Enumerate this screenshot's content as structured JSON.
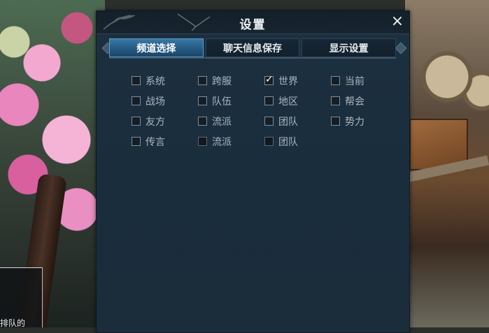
{
  "dialog": {
    "title": "设置",
    "close_symbol": "×"
  },
  "tabs": [
    {
      "label": "频道选择",
      "active": true
    },
    {
      "label": "聊天信息保存",
      "active": false
    },
    {
      "label": "显示设置",
      "active": false
    }
  ],
  "channels": [
    {
      "label": "系统",
      "checked": false
    },
    {
      "label": "跨服",
      "checked": false
    },
    {
      "label": "世界",
      "checked": true
    },
    {
      "label": "当前",
      "checked": false
    },
    {
      "label": "战场",
      "checked": false
    },
    {
      "label": "队伍",
      "checked": false
    },
    {
      "label": "地区",
      "checked": false
    },
    {
      "label": "帮会",
      "checked": false
    },
    {
      "label": "友方",
      "checked": false
    },
    {
      "label": "流派",
      "checked": false
    },
    {
      "label": "团队",
      "checked": false
    },
    {
      "label": "势力",
      "checked": false
    },
    {
      "label": "传言",
      "checked": false
    },
    {
      "label": "流派",
      "checked": false
    },
    {
      "label": "团队",
      "checked": false
    }
  ],
  "background_hud": {
    "queue_text": "排队的"
  },
  "colors": {
    "active_tab": "#2f6d9b",
    "dialog_bg": "#1c2f3e",
    "label_text": "#aab6bf"
  }
}
